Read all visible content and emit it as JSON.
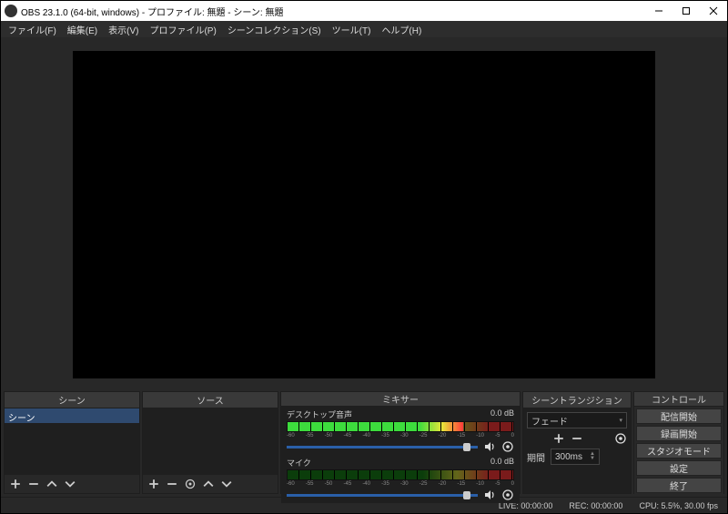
{
  "titlebar": {
    "text": "OBS 23.1.0 (64-bit, windows) - プロファイル: 無題 - シーン: 無題"
  },
  "menubar": {
    "items": [
      "ファイル(F)",
      "編集(E)",
      "表示(V)",
      "プロファイル(P)",
      "シーンコレクション(S)",
      "ツール(T)",
      "ヘルプ(H)"
    ]
  },
  "panels": {
    "scenes": {
      "title": "シーン",
      "items": [
        "シーン"
      ]
    },
    "sources": {
      "title": "ソース"
    },
    "mixer": {
      "title": "ミキサー",
      "tracks": [
        {
          "name": "デスクトップ音声",
          "db": "0.0 dB",
          "level_pct": 78
        },
        {
          "name": "マイク",
          "db": "0.0 dB",
          "level_pct": 0
        }
      ],
      "tick_labels": [
        "-60",
        "-55",
        "-50",
        "-45",
        "-40",
        "-35",
        "-30",
        "-25",
        "-20",
        "-15",
        "-10",
        "-5",
        "0"
      ]
    },
    "transitions": {
      "title": "シーントランジション",
      "selected": "フェード",
      "duration_label": "期間",
      "duration_value": "300ms"
    },
    "controls": {
      "title": "コントロール",
      "buttons": [
        "配信開始",
        "録画開始",
        "スタジオモード",
        "設定",
        "終了"
      ]
    }
  },
  "statusbar": {
    "live": "LIVE: 00:00:00",
    "rec": "REC: 00:00:00",
    "cpu": "CPU: 5.5%, 30.00 fps"
  }
}
